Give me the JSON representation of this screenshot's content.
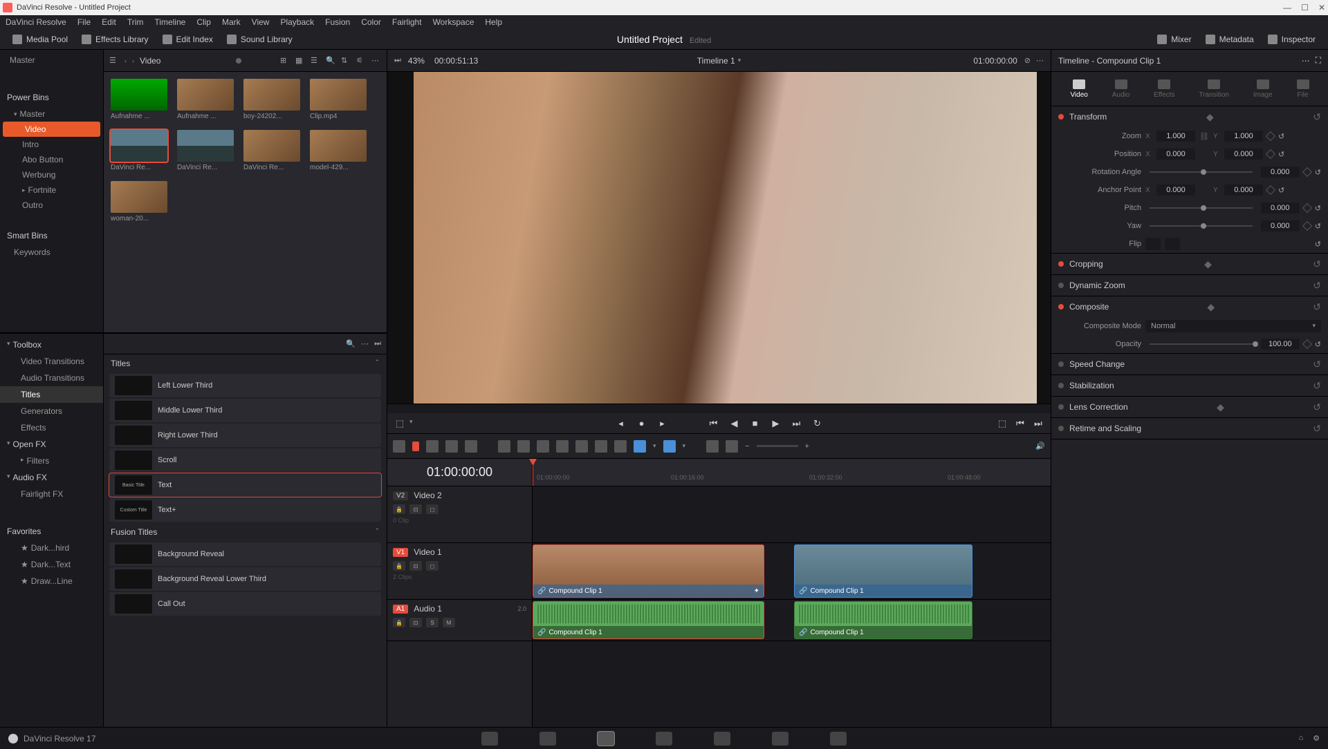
{
  "window": {
    "title": "DaVinci Resolve - Untitled Project"
  },
  "menubar": [
    "DaVinci Resolve",
    "File",
    "Edit",
    "Trim",
    "Timeline",
    "Clip",
    "Mark",
    "View",
    "Playback",
    "Fusion",
    "Color",
    "Fairlight",
    "Workspace",
    "Help"
  ],
  "toolbar": {
    "media_pool": "Media Pool",
    "effects_library": "Effects Library",
    "edit_index": "Edit Index",
    "sound_library": "Sound Library",
    "mixer": "Mixer",
    "metadata": "Metadata",
    "inspector": "Inspector",
    "project_title": "Untitled Project",
    "project_status": "Edited"
  },
  "media": {
    "breadcrumb": "Video",
    "bins": {
      "master": "Master",
      "power_bins": "Power Bins",
      "pb_master": "Master",
      "items": [
        "Video",
        "Intro",
        "Abo Button",
        "Werbung",
        "Fortnite",
        "Outro"
      ],
      "smart_bins": "Smart Bins",
      "keywords": "Keywords"
    },
    "clips": [
      {
        "label": "Aufnahme ...",
        "cls": "green"
      },
      {
        "label": "Aufnahme ...",
        "cls": "face"
      },
      {
        "label": "boy-24202...",
        "cls": "face"
      },
      {
        "label": "Clip.mp4",
        "cls": "face"
      },
      {
        "label": "DaVinci Re...",
        "cls": "land",
        "sel": true
      },
      {
        "label": "DaVinci Re...",
        "cls": "land"
      },
      {
        "label": "DaVinci Re...",
        "cls": "face"
      },
      {
        "label": "model-429...",
        "cls": "face"
      },
      {
        "label": "woman-20...",
        "cls": "face"
      }
    ]
  },
  "effects": {
    "sidebar": {
      "toolbox": "Toolbox",
      "items": [
        "Video Transitions",
        "Audio Transitions",
        "Titles",
        "Generators",
        "Effects"
      ],
      "openfx": "Open FX",
      "filters": "Filters",
      "audiofx": "Audio FX",
      "fairlightfx": "Fairlight FX",
      "favorites": "Favorites",
      "favs": [
        "Dark...hird",
        "Dark...Text",
        "Draw...Line"
      ]
    },
    "titles_header": "Titles",
    "fusion_header": "Fusion Titles",
    "titles": [
      {
        "name": "Left Lower Third",
        "prev": ""
      },
      {
        "name": "Middle Lower Third",
        "prev": ""
      },
      {
        "name": "Right Lower Third",
        "prev": ""
      },
      {
        "name": "Scroll",
        "prev": ""
      },
      {
        "name": "Text",
        "prev": "Basic Title",
        "sel": true
      },
      {
        "name": "Text+",
        "prev": "Custom Title"
      }
    ],
    "fusion_titles": [
      {
        "name": "Background Reveal"
      },
      {
        "name": "Background Reveal Lower Third"
      },
      {
        "name": "Call Out"
      }
    ]
  },
  "viewer": {
    "zoom_pct": "43%",
    "tc_left": "00:00:51:13",
    "timeline_name": "Timeline 1",
    "tc_right": "01:00:00:00"
  },
  "timeline": {
    "tc_display": "01:00:00:00",
    "ruler_ticks": [
      "01:00:00:00",
      "01:00:16:00",
      "01:00:32:00",
      "01:00:48:00"
    ],
    "tracks": {
      "v2": {
        "tag": "V2",
        "name": "Video 2",
        "meta": "0 Clip"
      },
      "v1": {
        "tag": "V1",
        "name": "Video 1",
        "meta": "2 Clips"
      },
      "a1": {
        "tag": "A1",
        "name": "Audio 1",
        "ch": "2.0"
      }
    },
    "clip_name": "Compound Clip 1"
  },
  "inspector": {
    "header": "Timeline - Compound Clip 1",
    "tabs": [
      "Video",
      "Audio",
      "Effects",
      "Transition",
      "Image",
      "File"
    ],
    "transform": {
      "title": "Transform",
      "zoom_lbl": "Zoom",
      "zoom_x": "1.000",
      "zoom_y": "1.000",
      "pos_lbl": "Position",
      "pos_x": "0.000",
      "pos_y": "0.000",
      "rot_lbl": "Rotation Angle",
      "rot": "0.000",
      "anchor_lbl": "Anchor Point",
      "anchor_x": "0.000",
      "anchor_y": "0.000",
      "pitch_lbl": "Pitch",
      "pitch": "0.000",
      "yaw_lbl": "Yaw",
      "yaw": "0.000",
      "flip_lbl": "Flip"
    },
    "sections": {
      "cropping": "Cropping",
      "dynamic_zoom": "Dynamic Zoom",
      "composite": "Composite",
      "composite_mode_lbl": "Composite Mode",
      "composite_mode": "Normal",
      "opacity_lbl": "Opacity",
      "opacity": "100.00",
      "speed_change": "Speed Change",
      "stabilization": "Stabilization",
      "lens_correction": "Lens Correction",
      "retime": "Retime and Scaling"
    }
  },
  "footer": {
    "version": "DaVinci Resolve 17"
  }
}
